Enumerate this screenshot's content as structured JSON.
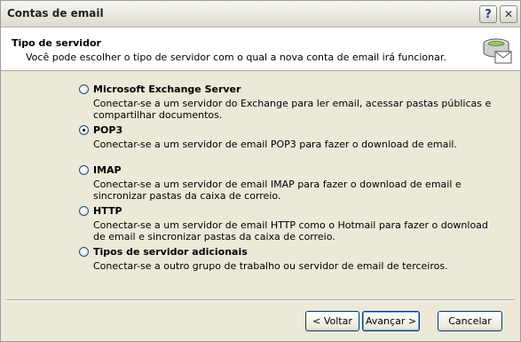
{
  "window": {
    "title": "Contas de email",
    "help_button": "?",
    "close_button": "✕"
  },
  "header": {
    "title": "Tipo de servidor",
    "subtitle": "Você pode escolher o tipo de servidor com o qual a nova conta de email irá funcionar.",
    "icon": "mail-server-icon"
  },
  "options": [
    {
      "label": "Microsoft Exchange Server",
      "description": "Conectar-se a um servidor do Exchange para ler email, acessar pastas públicas e compartilhar documentos.",
      "selected": false
    },
    {
      "label": "POP3",
      "description": "Conectar-se a um servidor de email POP3 para fazer o download de email.",
      "selected": true
    },
    {
      "label": "IMAP",
      "description": "Conectar-se a um servidor de email IMAP para fazer o download de email e sincronizar pastas da caixa de correio.",
      "selected": false
    },
    {
      "label": "HTTP",
      "description": "Conectar-se a um servidor de email HTTP como o Hotmail para fazer o download de email e sincronizar pastas da caixa de correio.",
      "selected": false
    },
    {
      "label": "Tipos de servidor adicionais",
      "description": "Conectar-se a outro grupo de trabalho ou servidor de email de terceiros.",
      "selected": false
    }
  ],
  "footer": {
    "back_label": "< Voltar",
    "next_label": "Avançar >",
    "cancel_label": "Cancelar"
  }
}
